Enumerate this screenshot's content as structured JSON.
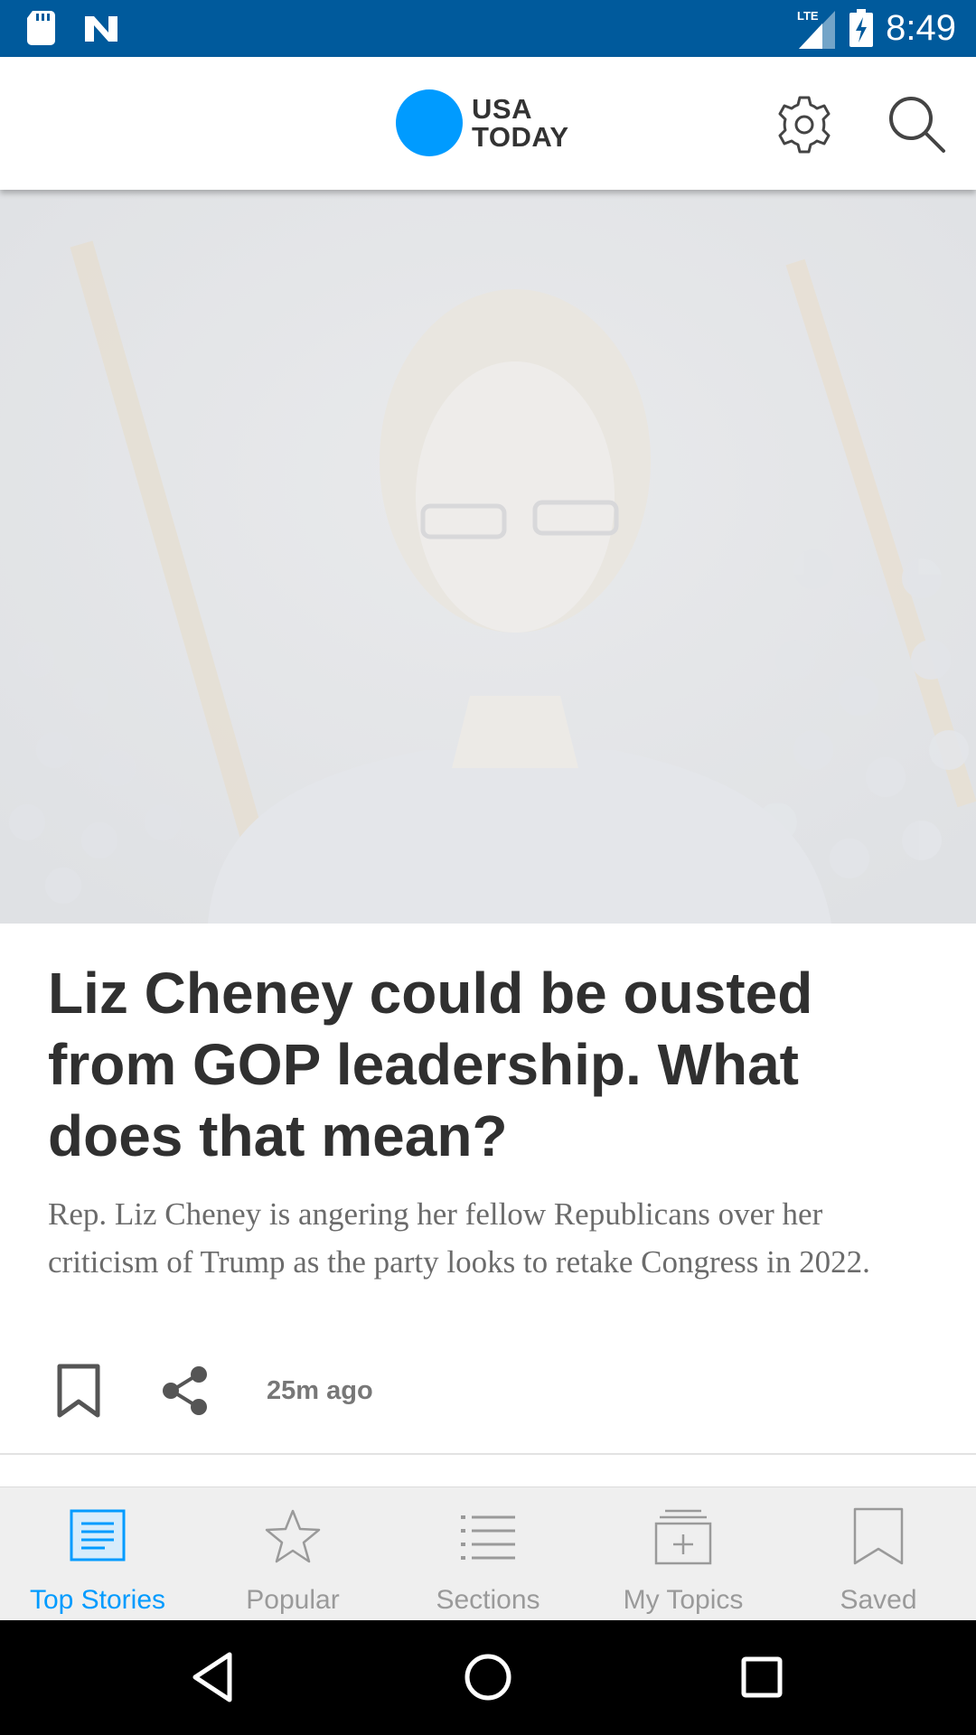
{
  "status_bar": {
    "time": "8:49",
    "network": "LTE",
    "icons": [
      "sd-card-icon",
      "n-app-icon",
      "lte-signal-icon",
      "battery-charging-icon"
    ]
  },
  "header": {
    "logo_line1": "USA",
    "logo_line2": "TODAY",
    "brand_color": "#009bff",
    "icons": [
      "settings-gear-icon",
      "search-icon"
    ]
  },
  "article": {
    "headline": "Liz Cheney could be ousted from GOP leadership. What does that mean?",
    "summary": "Rep. Liz Cheney is angering her fellow Republicans over her criticism of Trump as the party looks to retake Congress in 2022.",
    "timestamp": "25m ago",
    "action_icons": [
      "bookmark-icon",
      "share-icon"
    ]
  },
  "bottom_nav": {
    "active_color": "#009bff",
    "inactive_color": "#9a9a9a",
    "items": [
      {
        "label": "Top Stories",
        "icon": "top-stories-icon",
        "active": true
      },
      {
        "label": "Popular",
        "icon": "star-icon",
        "active": false
      },
      {
        "label": "Sections",
        "icon": "list-icon",
        "active": false
      },
      {
        "label": "My Topics",
        "icon": "add-topic-icon",
        "active": false
      },
      {
        "label": "Saved",
        "icon": "bookmark-icon",
        "active": false
      }
    ]
  },
  "system_nav": {
    "icons": [
      "back-icon",
      "home-icon",
      "recents-icon"
    ]
  }
}
